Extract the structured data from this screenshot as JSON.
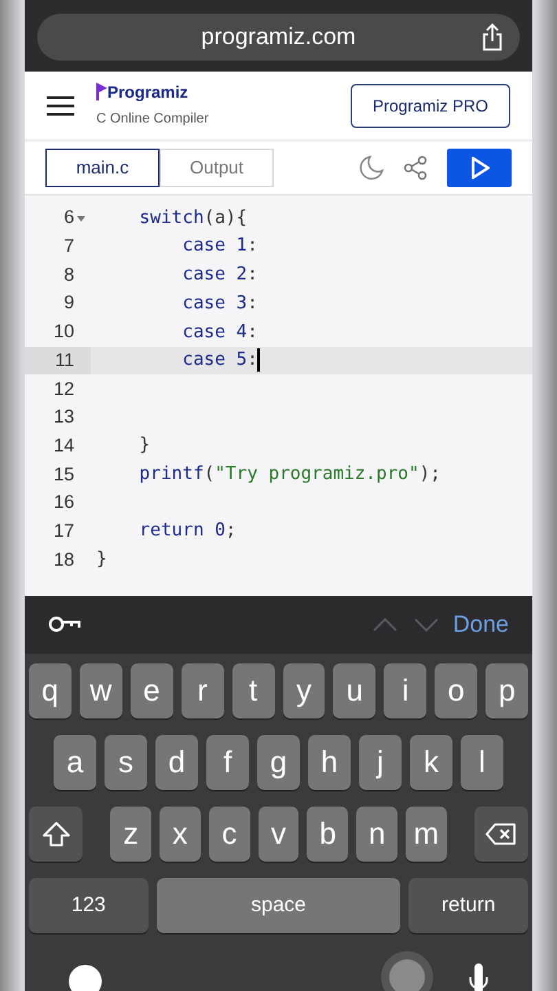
{
  "browser": {
    "url": "programiz.com"
  },
  "header": {
    "logo": "Programiz",
    "subtitle": "C Online Compiler",
    "pro_button": "Programiz PRO"
  },
  "tabs": [
    {
      "label": "main.c",
      "selected": true
    },
    {
      "label": "Output",
      "selected": false
    }
  ],
  "code_lines": [
    {
      "number": "6",
      "fold": true,
      "current": false,
      "tokens": [
        {
          "kind": "keyword",
          "text": "    switch"
        },
        {
          "kind": "plain",
          "text": "(a){"
        }
      ]
    },
    {
      "number": "7",
      "fold": false,
      "current": false,
      "tokens": [
        {
          "kind": "keyword",
          "text": "        case "
        },
        {
          "kind": "number",
          "text": "1"
        },
        {
          "kind": "plain",
          "text": ":"
        }
      ]
    },
    {
      "number": "8",
      "fold": false,
      "current": false,
      "tokens": [
        {
          "kind": "keyword",
          "text": "        case "
        },
        {
          "kind": "number",
          "text": "2"
        },
        {
          "kind": "plain",
          "text": ":"
        }
      ]
    },
    {
      "number": "9",
      "fold": false,
      "current": false,
      "tokens": [
        {
          "kind": "keyword",
          "text": "        case "
        },
        {
          "kind": "number",
          "text": "3"
        },
        {
          "kind": "plain",
          "text": ":"
        }
      ]
    },
    {
      "number": "10",
      "fold": false,
      "current": false,
      "tokens": [
        {
          "kind": "keyword",
          "text": "        case "
        },
        {
          "kind": "number",
          "text": "4"
        },
        {
          "kind": "plain",
          "text": ":"
        }
      ]
    },
    {
      "number": "11",
      "fold": false,
      "current": true,
      "tokens": [
        {
          "kind": "keyword",
          "text": "        case "
        },
        {
          "kind": "number",
          "text": "5"
        },
        {
          "kind": "plain",
          "text": ":"
        }
      ]
    },
    {
      "number": "12",
      "fold": false,
      "current": false
    },
    {
      "number": "13",
      "fold": false,
      "current": false
    },
    {
      "number": "14",
      "fold": false,
      "current": false,
      "tokens": [
        {
          "kind": "plain",
          "text": "    }"
        }
      ]
    },
    {
      "number": "15",
      "fold": false,
      "current": false,
      "tokens": [
        {
          "kind": "keyword",
          "text": "    printf"
        },
        {
          "kind": "plain",
          "text": "("
        },
        {
          "kind": "string",
          "text": "\"Try programiz.pro\""
        },
        {
          "kind": "plain",
          "text": ");"
        }
      ]
    },
    {
      "number": "16",
      "fold": false,
      "current": false
    },
    {
      "number": "17",
      "fold": false,
      "current": false,
      "tokens": [
        {
          "kind": "keyword",
          "text": "    return "
        },
        {
          "kind": "number",
          "text": "0"
        },
        {
          "kind": "plain",
          "text": ";"
        }
      ]
    },
    {
      "number": "18",
      "fold": false,
      "current": false,
      "tokens": [
        {
          "kind": "plain",
          "text": "}"
        }
      ]
    }
  ],
  "keyboard_bar": {
    "done": "Done"
  },
  "keyboard_rows": [
    [
      {
        "kind": "letter",
        "label": "q"
      },
      {
        "kind": "letter",
        "label": "w"
      },
      {
        "kind": "letter",
        "label": "e"
      },
      {
        "kind": "letter",
        "label": "r"
      },
      {
        "kind": "letter",
        "label": "t"
      },
      {
        "kind": "letter",
        "label": "y"
      },
      {
        "kind": "letter",
        "label": "u"
      },
      {
        "kind": "letter",
        "label": "i"
      },
      {
        "kind": "letter",
        "label": "o"
      },
      {
        "kind": "letter",
        "label": "p"
      }
    ],
    [
      {
        "kind": "letter",
        "label": "a"
      },
      {
        "kind": "letter",
        "label": "s"
      },
      {
        "kind": "letter",
        "label": "d"
      },
      {
        "kind": "letter",
        "label": "f"
      },
      {
        "kind": "letter",
        "label": "g"
      },
      {
        "kind": "letter",
        "label": "h"
      },
      {
        "kind": "letter",
        "label": "j"
      },
      {
        "kind": "letter",
        "label": "k"
      },
      {
        "kind": "letter",
        "label": "l"
      }
    ],
    [
      {
        "kind": "shift"
      },
      {
        "kind": "letter",
        "label": "z"
      },
      {
        "kind": "letter",
        "label": "x"
      },
      {
        "kind": "letter",
        "label": "c"
      },
      {
        "kind": "letter",
        "label": "v"
      },
      {
        "kind": "letter",
        "label": "b"
      },
      {
        "kind": "letter",
        "label": "n"
      },
      {
        "kind": "letter",
        "label": "m"
      },
      {
        "kind": "delete"
      }
    ],
    [
      {
        "kind": "numbers",
        "label": "123"
      },
      {
        "kind": "space",
        "label": "space"
      },
      {
        "kind": "return",
        "label": "return"
      }
    ]
  ]
}
